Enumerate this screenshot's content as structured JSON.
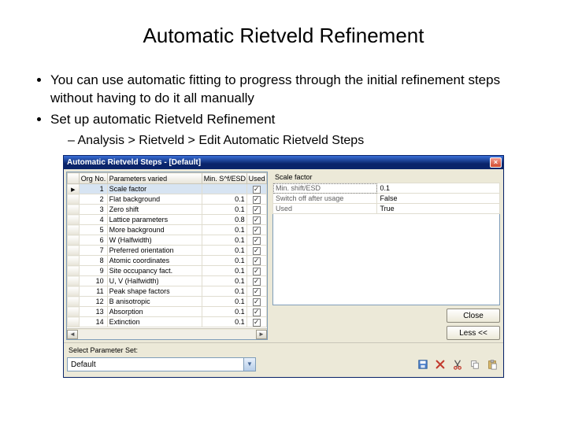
{
  "slide": {
    "title": "Automatic Rietveld Refinement",
    "bullet1": "You can use automatic fitting to progress through the initial refinement steps without having to do it all manually",
    "bullet2": "Set up automatic Rietveld Refinement",
    "sub1": "Analysis > Rietveld > Edit Automatic Rietveld Steps"
  },
  "dialog": {
    "title": "Automatic Rietveld Steps - [Default]",
    "columns": {
      "org": "Org No.",
      "param": "Parameters varied",
      "min": "Min. S^f/ESD",
      "used": "Used"
    },
    "rows": [
      {
        "n": 1,
        "param": "Scale factor",
        "min": "",
        "used": true,
        "selected": true
      },
      {
        "n": 2,
        "param": "Flat background",
        "min": "0.1",
        "used": true
      },
      {
        "n": 3,
        "param": "Zero shift",
        "min": "0.1",
        "used": true
      },
      {
        "n": 4,
        "param": "Lattice parameters",
        "min": "0.8",
        "used": true
      },
      {
        "n": 5,
        "param": "More background",
        "min": "0.1",
        "used": true
      },
      {
        "n": 6,
        "param": "W (Halfwidth)",
        "min": "0.1",
        "used": true
      },
      {
        "n": 7,
        "param": "Preferred orientation",
        "min": "0.1",
        "used": true
      },
      {
        "n": 8,
        "param": "Atomic coordinates",
        "min": "0.1",
        "used": true
      },
      {
        "n": 9,
        "param": "Site occupancy fact.",
        "min": "0.1",
        "used": true
      },
      {
        "n": 10,
        "param": "U, V (Halfwidth)",
        "min": "0.1",
        "used": true
      },
      {
        "n": 11,
        "param": "Peak shape factors",
        "min": "0.1",
        "used": true
      },
      {
        "n": 12,
        "param": "B anisotropic",
        "min": "0.1",
        "used": true
      },
      {
        "n": 13,
        "param": "Absorption",
        "min": "0.1",
        "used": true
      },
      {
        "n": 14,
        "param": "Extinction",
        "min": "0.1",
        "used": true
      }
    ],
    "detail": {
      "head": "Scale factor",
      "minKey": "Min. shift/ESD",
      "minVal": "0.1",
      "swKey": "Switch off after usage",
      "swVal": "False",
      "usedKey": "Used",
      "usedVal": "True"
    },
    "btn_close": "Close",
    "btn_less": "Less <<",
    "foot_label": "Select Parameter Set:",
    "combo_value": "Default"
  }
}
